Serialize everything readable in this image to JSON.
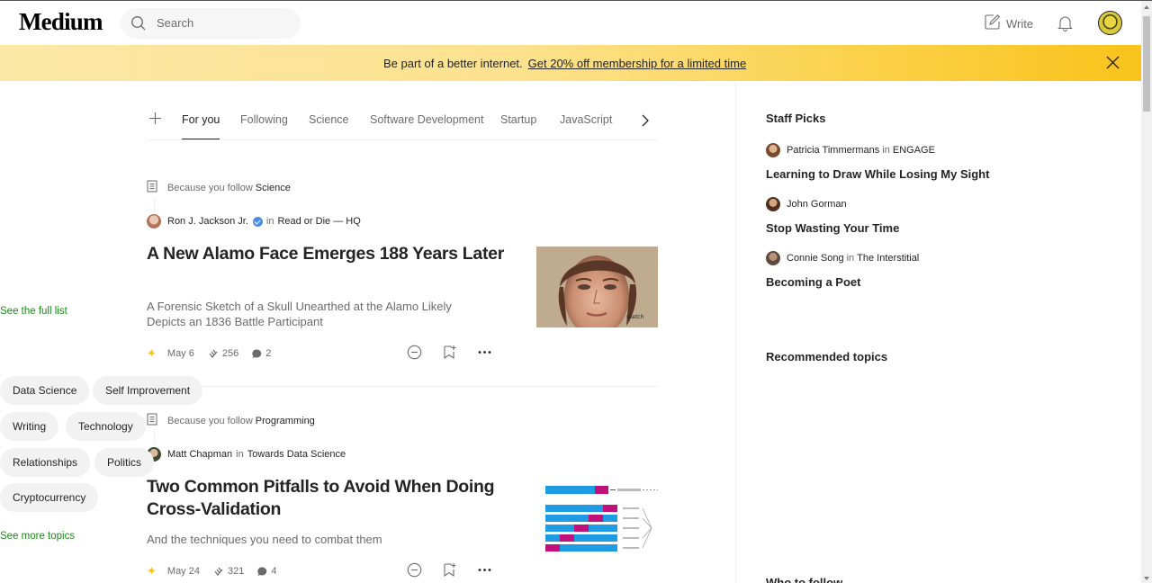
{
  "header": {
    "logo": "Medium",
    "search_placeholder": "Search",
    "write_label": "Write"
  },
  "banner": {
    "text": "Be part of a better internet.",
    "link": "Get 20% off membership for a limited time",
    "background": "#fbd24b"
  },
  "tabs": {
    "items": [
      "For you",
      "Following",
      "Science",
      "Software Development",
      "Startup",
      "JavaScript"
    ],
    "active": "For you"
  },
  "articles": [
    {
      "reason_prefix": "Because you follow",
      "reason_topic": "Science",
      "author": "Ron J. Jackson Jr.",
      "in": "in",
      "publication": "Read or Die — HQ",
      "title": "A New Alamo Face Emerges 188 Years Later",
      "subtitle": "A Forensic Sketch of a Skull Unearthed at the Alamo Likely Depicts an 1836 Battle Participant",
      "date": "May 6",
      "claps": "256",
      "responses": "2"
    },
    {
      "reason_prefix": "Because you follow",
      "reason_topic": "Programming",
      "author": "Matt Chapman",
      "in": "in",
      "publication": "Towards Data Science",
      "title": "Two Common Pitfalls to Avoid When Doing Cross-Validation",
      "subtitle": "And the techniques you need to combat them",
      "date": "May 24",
      "claps": "321",
      "responses": "4"
    }
  ],
  "sidebar": {
    "staff_picks_heading": "Staff Picks",
    "picks": [
      {
        "author": "Patricia Timmermans",
        "in": "in",
        "publication": "ENGAGE",
        "title": "Learning to Draw While Losing My Sight"
      },
      {
        "author": "John Gorman",
        "in": "",
        "publication": "",
        "title": "Stop Wasting Your Time"
      },
      {
        "author": "Connie Song",
        "in": "in",
        "publication": "The Interstitial",
        "title": "Becoming a Poet"
      }
    ],
    "see_full_list": "See the full list",
    "topics_heading": "Recommended topics",
    "topics": [
      "Data Science",
      "Self Improvement",
      "Writing",
      "Technology",
      "Relationships",
      "Politics",
      "Cryptocurrency"
    ],
    "see_more_topics": "See more topics",
    "who_to_follow": "Who to follow"
  },
  "colors": {
    "accent_green": "#1a8917",
    "member_star": "#ffc017",
    "text_primary": "#242424",
    "text_secondary": "#6b6b6b"
  }
}
